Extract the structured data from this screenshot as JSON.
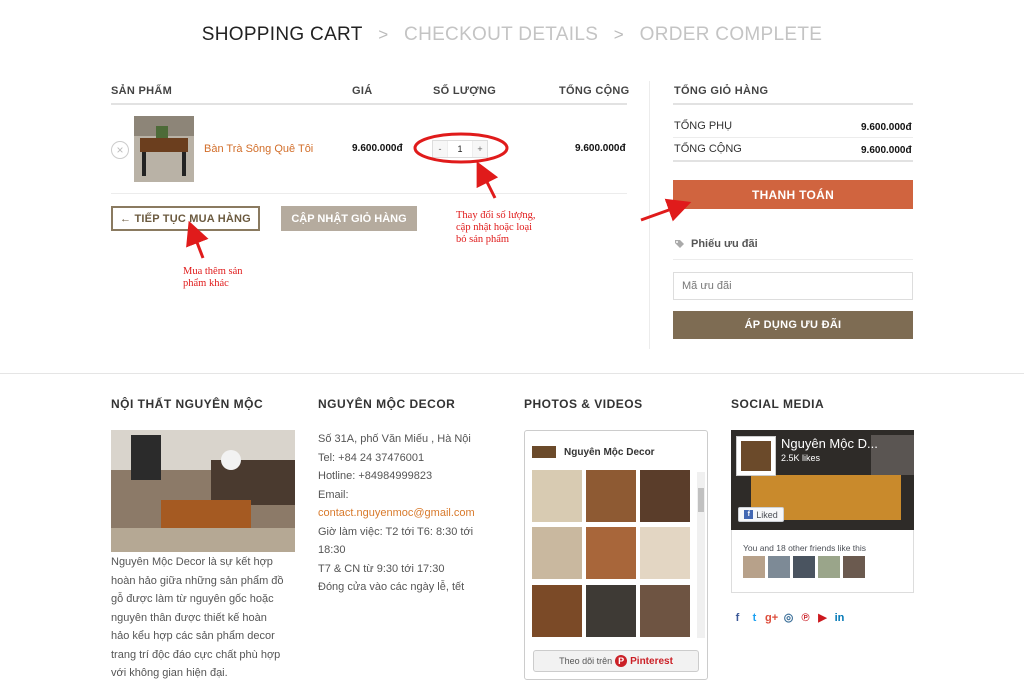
{
  "steps": {
    "step1": "SHOPPING CART",
    "step2": "CHECKOUT DETAILS",
    "step3": "ORDER COMPLETE",
    "separator": ">"
  },
  "cart": {
    "headers": {
      "product": "SẢN PHẨM",
      "price": "GIÁ",
      "quantity": "SỐ LƯỢNG",
      "subtotal": "TỔNG CỘNG"
    },
    "item": {
      "remove": "×",
      "name": "Bàn Trà Sông Quê Tôi",
      "price": "9.600.000đ",
      "qty_minus": "-",
      "qty": "1",
      "qty_plus": "+",
      "subtotal": "9.600.000đ"
    },
    "continue_label": "← TIẾP TỤC MUA HÀNG",
    "update_label": "CẬP NHẬT GIỎ HÀNG"
  },
  "totals": {
    "heading": "TỔNG GIỎ HÀNG",
    "subtotal_label": "TỔNG PHỤ",
    "subtotal_value": "9.600.000đ",
    "total_label": "TỔNG CỘNG",
    "total_value": "9.600.000đ",
    "checkout_label": "THANH TOÁN",
    "coupon_title": "Phiếu ưu đãi",
    "coupon_placeholder": "Mã ưu đãi",
    "apply_label": "ÁP DỤNG ƯU ĐÃI"
  },
  "annotations": {
    "qty_note_1": "Thay đổi số lượng,",
    "qty_note_2": "cập nhật hoặc loại",
    "qty_note_3": "bỏ sản phẩm",
    "continue_note_1": "Mua thêm sản",
    "continue_note_2": "phẩm khác",
    "color": "#e01b1b"
  },
  "footer": {
    "col1": {
      "heading": "NỘI THẤT NGUYÊN MỘC",
      "lines": [
        "Nguyên Mộc Decor là sự kết hợp",
        "hoàn hảo giữa những sản phẩm đồ",
        "gỗ được làm từ nguyên gốc hoặc",
        "nguyên thân được thiết kế hoàn",
        "hảo kểu hợp các sản phẩm decor",
        "trang trí độc đáo cực chất phù hợp",
        "với không gian hiện đại."
      ]
    },
    "col2": {
      "heading": "NGUYÊN MỘC DECOR",
      "address": "Số 31A, phố Văn Miếu , Hà Nội",
      "tel": "Tel: +84 24 37476001",
      "hotline": "Hotline: +84984999823",
      "email_label": "Email:",
      "email": "contact.nguyenmoc@gmail.com",
      "hours_1": "Giờ làm việc: T2 tới T6: 8:30 tới",
      "hours_2": "18:30",
      "hours_3": "T7 & CN từ 9:30 tới 17:30",
      "closed": "Đóng cửa vào các ngày lễ, tết"
    },
    "col3": {
      "heading": "PHOTOS & VIDEOS",
      "board_name": "Nguyên Mộc Decor",
      "follow_prefix": "Theo dõi trên",
      "follow_brand": "Pinterest"
    },
    "col4": {
      "heading": "SOCIAL MEDIA",
      "page_name": "Nguyên Mộc D...",
      "likes": "2.5K likes",
      "like_button": "Liked",
      "friends_text": "You and 18 other friends like this",
      "icons": [
        "facebook-icon",
        "twitter-icon",
        "google-plus-icon",
        "instagram-icon",
        "pinterest-icon",
        "youtube-icon",
        "linkedin-icon"
      ]
    }
  },
  "colors": {
    "accent_orange": "#d0643f",
    "brown": "#7e6c53",
    "link_orange": "#d26e2a"
  }
}
